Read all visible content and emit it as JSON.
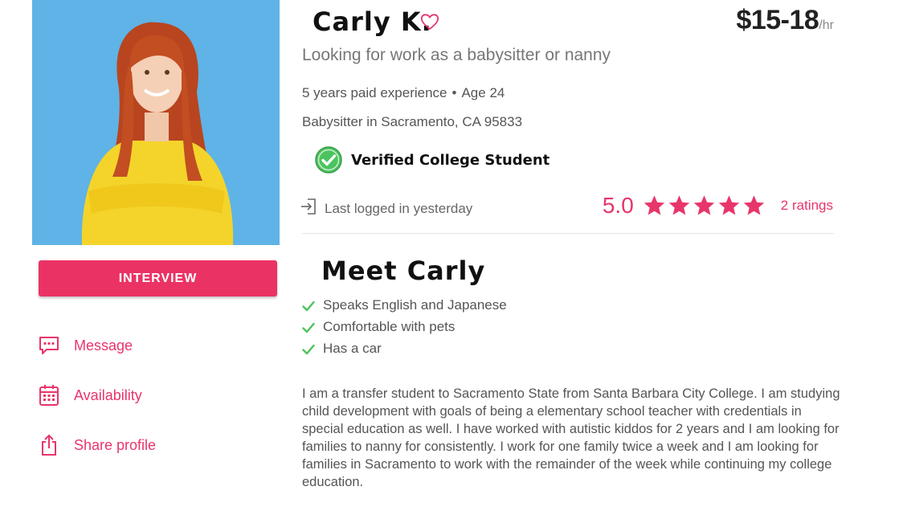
{
  "profile": {
    "name": "Carly K.",
    "rate_amount": "$15-18",
    "rate_unit": "/hr",
    "tagline": "Looking for work as a babysitter or nanny",
    "experience": "5 years paid experience",
    "age": "Age 24",
    "location": "Babysitter in Sacramento, CA 95833",
    "verified_label": "Verified College Student",
    "last_login": "Last logged in yesterday",
    "rating_score": "5.0",
    "rating_stars": 5,
    "rating_count": "2 ratings"
  },
  "actions": {
    "interview_label": "INTERVIEW",
    "message_label": "Message",
    "availability_label": "Availability",
    "share_label": "Share profile"
  },
  "about": {
    "heading": "Meet Carly",
    "traits": [
      "Speaks English and Japanese",
      "Comfortable with pets",
      "Has a car"
    ],
    "bio": "I am a transfer student to Sacramento State from Santa Barbara City College. I am studying child development with goals of being a elementary school teacher with credentials in special education as well. I have worked with autistic kiddos for 2 years and I am looking for families to nanny for consistently. I work for one family twice a week and I am looking for families in Sacramento to work with the remainder of the week while continuing my college education."
  },
  "colors": {
    "accent": "#e8356a",
    "button": "#ea3364",
    "photo_background": "#5fb3e6",
    "check_green": "#4cc35e"
  },
  "icons": {
    "heart": "heart-outline-icon",
    "verified": "check-circle-icon",
    "login": "sign-in-icon",
    "star": "star-icon",
    "check": "checkmark-icon",
    "message": "chat-bubble-icon",
    "availability": "calendar-icon",
    "share": "share-icon"
  }
}
